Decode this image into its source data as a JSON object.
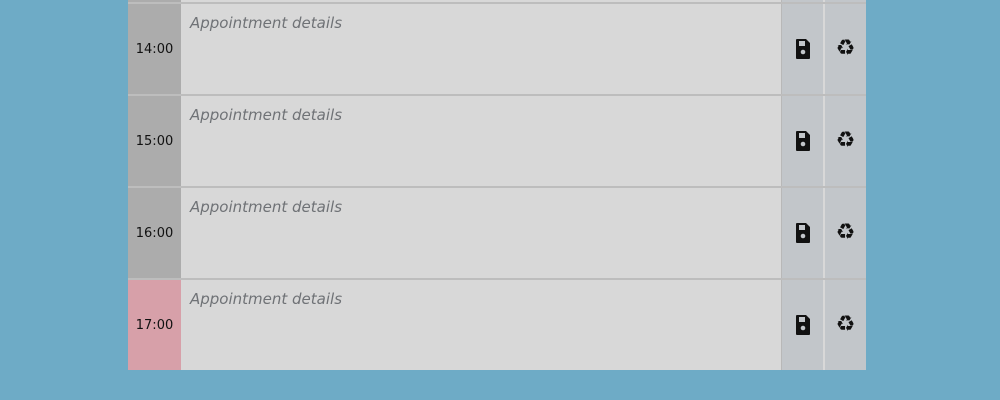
{
  "placeholder": "Appointment details",
  "rows": [
    {
      "hour": "14:00",
      "status": "present"
    },
    {
      "hour": "15:00",
      "status": "present"
    },
    {
      "hour": "16:00",
      "status": "present"
    },
    {
      "hour": "17:00",
      "status": "past"
    }
  ],
  "icons": {
    "save": "save-icon",
    "delete": "recycle-icon"
  },
  "colors": {
    "background": "#6eabc6",
    "hour_cell": "#acacac",
    "hour_cell_past": "#d7a0a9",
    "details": "#d8d8d8",
    "button": "#c2c6ca"
  }
}
